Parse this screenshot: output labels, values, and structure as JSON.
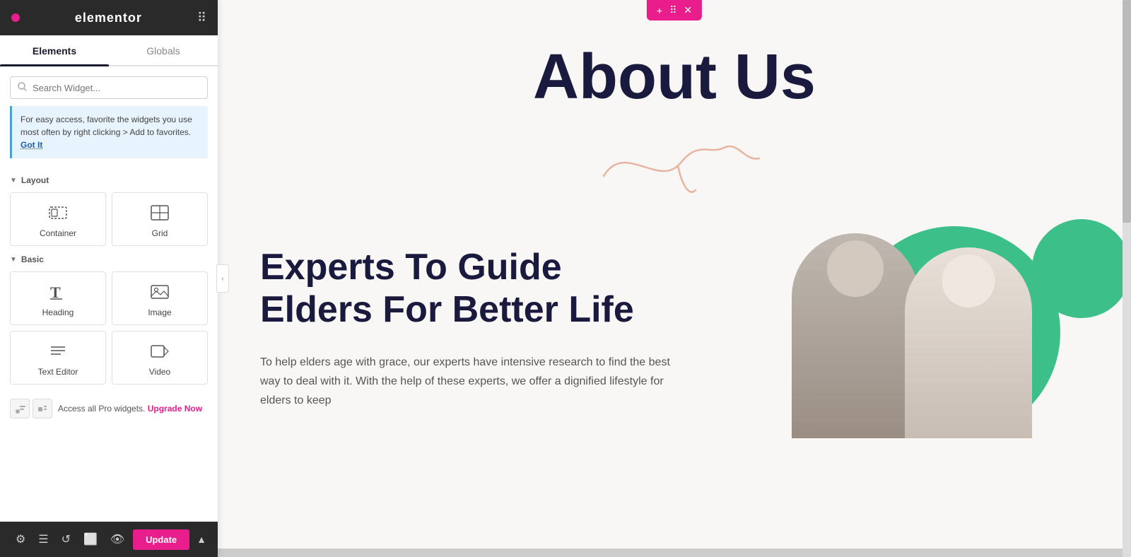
{
  "topbar": {
    "logo": "elementor",
    "dot_color": "#e91e8c"
  },
  "tabs": {
    "elements_label": "Elements",
    "globals_label": "Globals",
    "active": "elements"
  },
  "search": {
    "placeholder": "Search Widget..."
  },
  "info_box": {
    "text": "For easy access, favorite the widgets you use most often by right clicking > Add to favorites.",
    "link_text": "Got It"
  },
  "layout_section": {
    "label": "Layout",
    "widgets": [
      {
        "id": "container",
        "label": "Container",
        "icon": "container-icon"
      },
      {
        "id": "grid",
        "label": "Grid",
        "icon": "grid-icon"
      }
    ]
  },
  "basic_section": {
    "label": "Basic",
    "widgets": [
      {
        "id": "heading",
        "label": "Heading",
        "icon": "heading-icon"
      },
      {
        "id": "image",
        "label": "Image",
        "icon": "image-icon"
      },
      {
        "id": "text-editor",
        "label": "Text Editor",
        "icon": "text-icon"
      },
      {
        "id": "video",
        "label": "Video",
        "icon": "video-icon"
      }
    ]
  },
  "pro_bar": {
    "text": "Access all Pro widgets.",
    "link_text": "Upgrade Now"
  },
  "bottom_toolbar": {
    "update_label": "Update"
  },
  "element_toolbar": {
    "add": "+",
    "move": "⠿",
    "close": "✕"
  },
  "canvas": {
    "about_us_title": "About Us",
    "content_heading_line1": "Experts To Guide",
    "content_heading_line2": "Elders For Better Life",
    "content_body": "To help elders age with grace, our experts have intensive research to find the best way to deal with it. With the help of these experts, we offer a dignified lifestyle for elders to keep"
  }
}
